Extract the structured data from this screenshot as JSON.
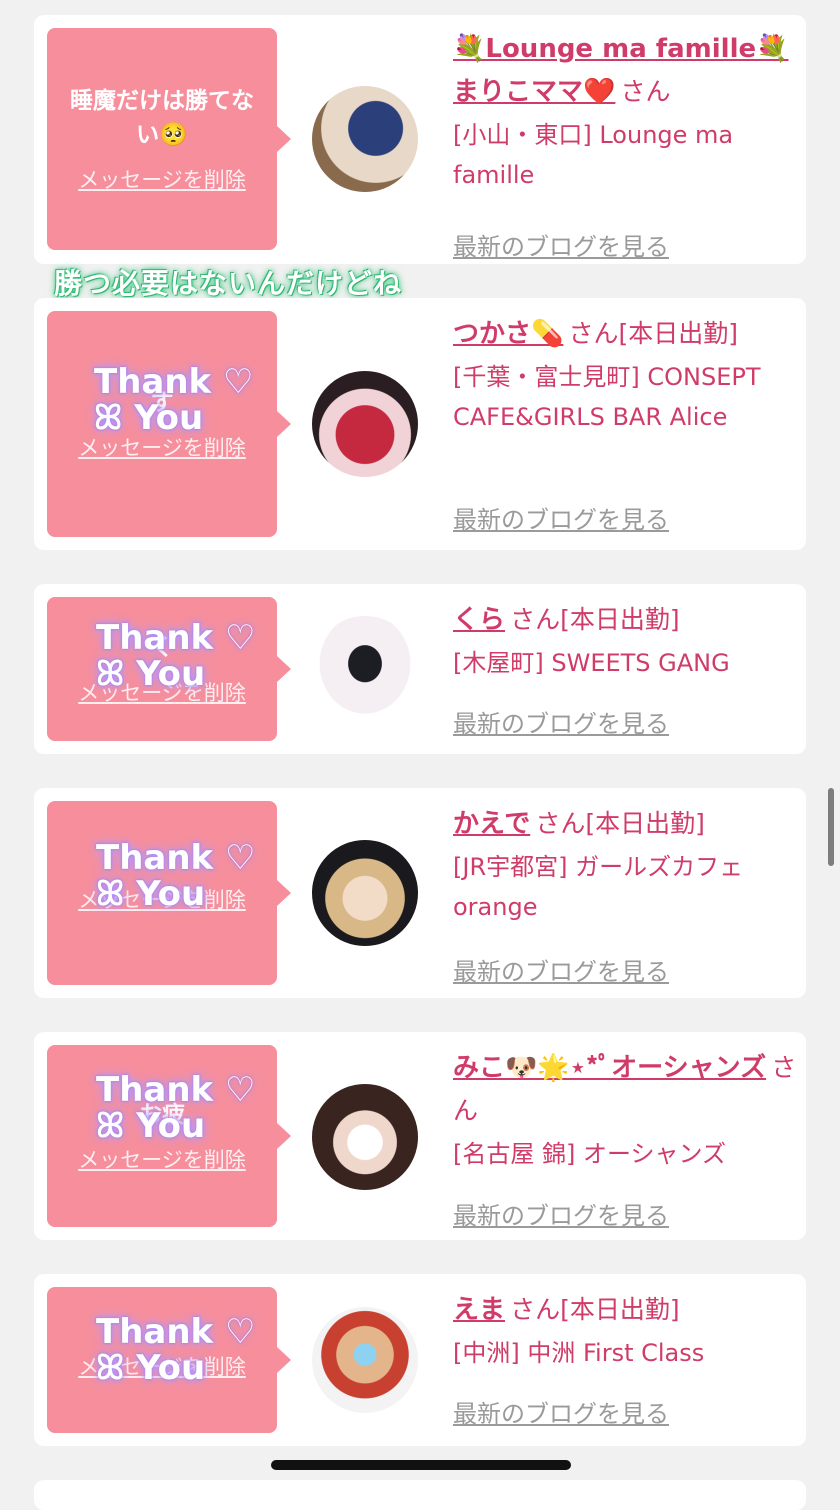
{
  "cards": [
    {
      "message": "睡魔だけは勝てな\nい🥺",
      "delete_label": "メッセージを削除",
      "name": "💐Lounge ma famille💐\nまりこママ❤️",
      "san": "さん",
      "shop": "[小山・東口] Lounge ma famille",
      "blog_label": "最新のブログを見る"
    },
    {
      "message": "す",
      "delete_label": "メッセージを削除",
      "name": "つかさ💊",
      "san": "さん[本日出勤]",
      "shop": "[千葉・富士見町] CONSEPT CAFE&GIRLS BAR Alice",
      "blog_label": "最新のブログを見る"
    },
    {
      "message": "く",
      "delete_label": "メッセージを削除",
      "name": "くら",
      "san": "さん[本日出勤]",
      "shop": "[木屋町] SWEETS GANG",
      "blog_label": "最新のブログを見る"
    },
    {
      "message": "",
      "delete_label": "メッセージを削除",
      "name": "かえで",
      "san": "さん[本日出勤]",
      "shop": "[JR宇都宮] ガールズカフェorange",
      "blog_label": "最新のブログを見る"
    },
    {
      "message": "お疲",
      "delete_label": "メッセージを削除",
      "name": "みこ🐶🌟⋆*ﾟオーシャンズ",
      "san": "さん",
      "shop": "[名古屋 錦] オーシャンズ",
      "blog_label": "最新のブログを見る"
    },
    {
      "message": "",
      "delete_label": "メッセージを削除",
      "name": "えま",
      "san": "さん[本日出勤]",
      "shop": "[中洲] 中洲 First Class",
      "blog_label": "最新のブログを見る"
    }
  ],
  "overlay": {
    "sticker_text": "勝つ必要はないんだけどね",
    "thank_line1": "Thank ♡",
    "thank_line2": "ꕤ You"
  }
}
